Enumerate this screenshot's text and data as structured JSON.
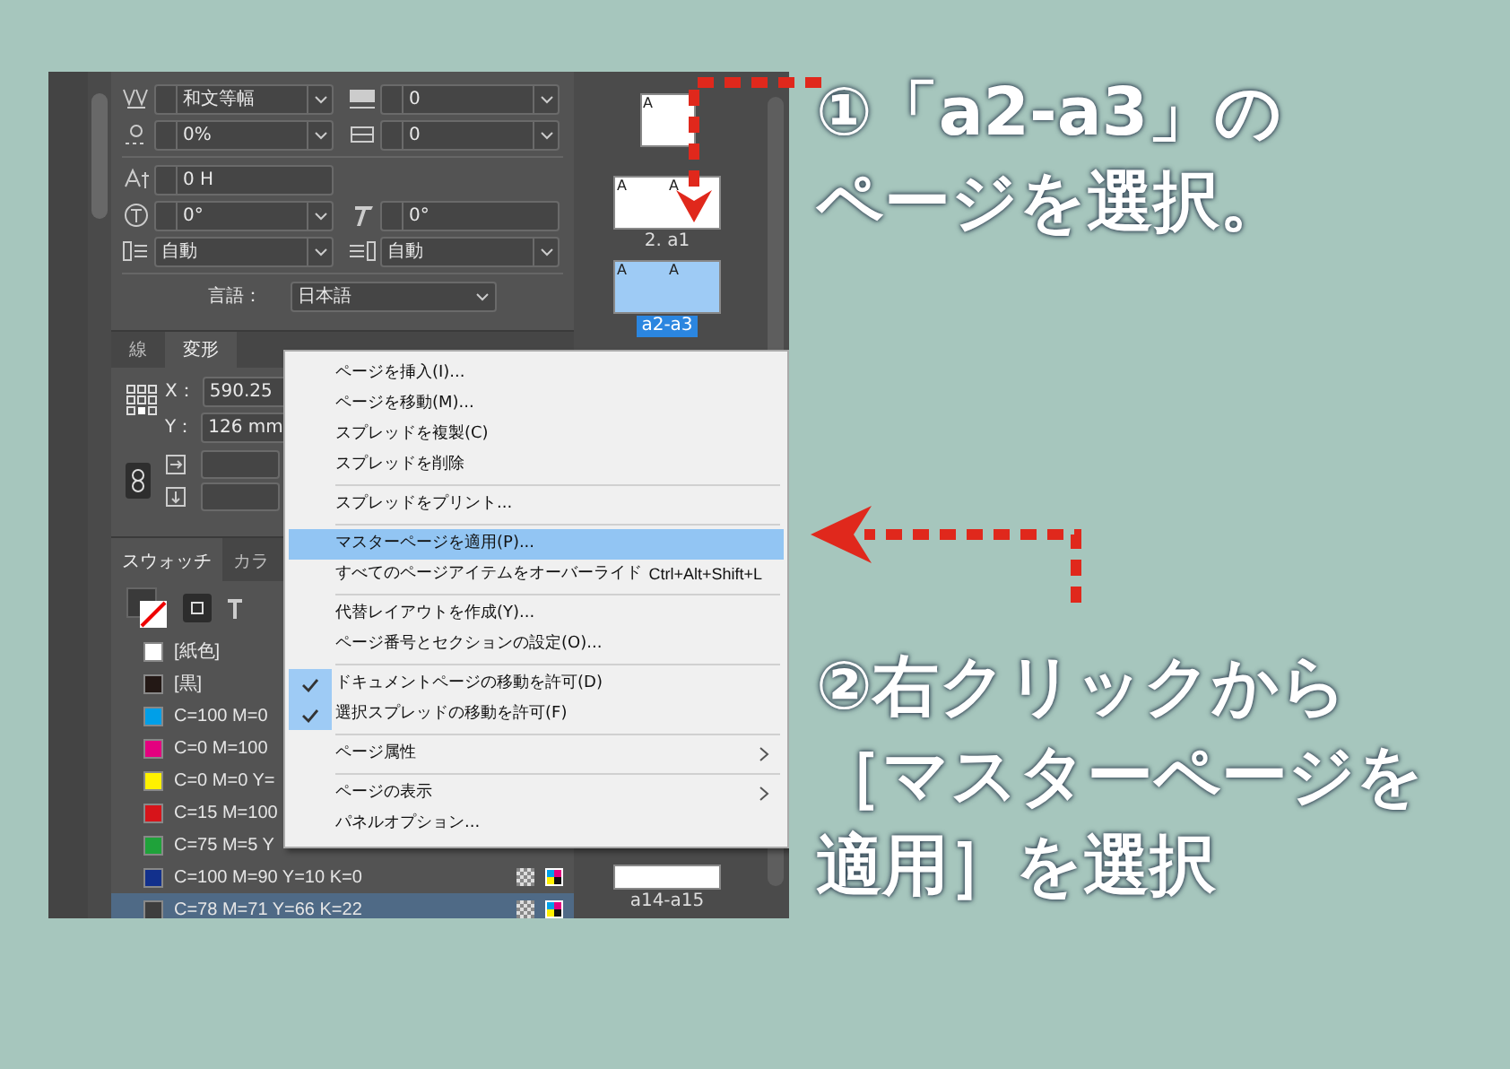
{
  "character_panel": {
    "rows": [
      [
        {
          "value": "和文等幅",
          "stepper": true,
          "dropdown": true
        },
        {
          "value": "0",
          "stepper": true,
          "dropdown": true
        }
      ],
      [
        {
          "value": "0%",
          "stepper": true,
          "dropdown": true
        },
        {
          "value": "0",
          "stepper": true,
          "dropdown": true
        }
      ],
      [
        {
          "value": "0 H",
          "stepper": true,
          "dropdown": false
        }
      ],
      [
        {
          "value": "0°",
          "stepper": true,
          "dropdown": true
        },
        {
          "value": "0°",
          "stepper": true,
          "dropdown": false
        }
      ],
      [
        {
          "value": "自動",
          "stepper": false,
          "dropdown": true
        },
        {
          "value": "自動",
          "stepper": false,
          "dropdown": true
        }
      ]
    ],
    "language": {
      "label": "言語：",
      "value": "日本語"
    }
  },
  "panel_tabs": [
    {
      "label": "線",
      "selected": false
    },
    {
      "label": "変形",
      "selected": true
    }
  ],
  "transform": {
    "x_label": "X：",
    "x_value": "590.25",
    "y_label": "Y：",
    "y_value": "126 mm"
  },
  "swatch_tabs": [
    {
      "label": "スウォッチ",
      "selected": true
    },
    {
      "label": "カラ",
      "selected": false
    }
  ],
  "swatches": [
    {
      "name": "[紙色]",
      "color": "#ffffff",
      "selected": false
    },
    {
      "name": "[黒]",
      "color": "#231815",
      "selected": false
    },
    {
      "name": "C=100 M=0",
      "color": "#009fe8",
      "selected": false
    },
    {
      "name": "C=0 M=100",
      "color": "#e4007f",
      "selected": false
    },
    {
      "name": "C=0 M=0 Y=",
      "color": "#fff100",
      "selected": false
    },
    {
      "name": "C=15 M=100",
      "color": "#d7141a",
      "selected": false
    },
    {
      "name": "C=75 M=5 Y",
      "color": "#1fa23a",
      "selected": false
    },
    {
      "name": "C=100 M=90 Y=10 K=0",
      "color": "#12308c",
      "selected": false
    },
    {
      "name": "C=78 M=71 Y=66 K=22",
      "color": "#3e3e3e",
      "selected": true
    }
  ],
  "pages": [
    {
      "spread": false,
      "masters": [
        "A"
      ],
      "selected": false
    },
    {
      "label": "2. a1",
      "spread": true,
      "masters": [
        "A",
        "A"
      ],
      "selected": false
    },
    {
      "label": "a2-a3",
      "spread": true,
      "masters": [
        "A",
        "A"
      ],
      "selected": true
    },
    {
      "label": "a14-a15",
      "spread": true,
      "selected": false
    }
  ],
  "context_menu": [
    {
      "kind": "item",
      "label": "ページを挿入(I)..."
    },
    {
      "kind": "item",
      "label": "ページを移動(M)..."
    },
    {
      "kind": "item",
      "label": "スプレッドを複製(C)"
    },
    {
      "kind": "item",
      "label": "スプレッドを削除"
    },
    {
      "kind": "separator"
    },
    {
      "kind": "item",
      "label": "スプレッドをプリント..."
    },
    {
      "kind": "separator"
    },
    {
      "kind": "item",
      "label": "マスターページを適用(P)...",
      "selected": true
    },
    {
      "kind": "item",
      "label": "すべてのページアイテムをオーバーライド",
      "shortcut": "Ctrl+Alt+Shift+L"
    },
    {
      "kind": "separator"
    },
    {
      "kind": "item",
      "label": "代替レイアウトを作成(Y)..."
    },
    {
      "kind": "item",
      "label": "ページ番号とセクションの設定(O)..."
    },
    {
      "kind": "separator"
    },
    {
      "kind": "item",
      "label": "ドキュメントページの移動を許可(D)",
      "checked": true
    },
    {
      "kind": "item",
      "label": "選択スプレッドの移動を許可(F)",
      "checked": true
    },
    {
      "kind": "separator"
    },
    {
      "kind": "submenu",
      "label": "ページ属性"
    },
    {
      "kind": "separator"
    },
    {
      "kind": "submenu",
      "label": "ページの表示"
    },
    {
      "kind": "item",
      "label": "パネルオプション..."
    }
  ],
  "annotations": [
    {
      "lines": [
        "①「a2-a3」の",
        "ページを選択。"
      ]
    },
    {
      "lines": [
        "②右クリックから",
        "［マスターページを",
        "適用］を選択"
      ]
    }
  ]
}
